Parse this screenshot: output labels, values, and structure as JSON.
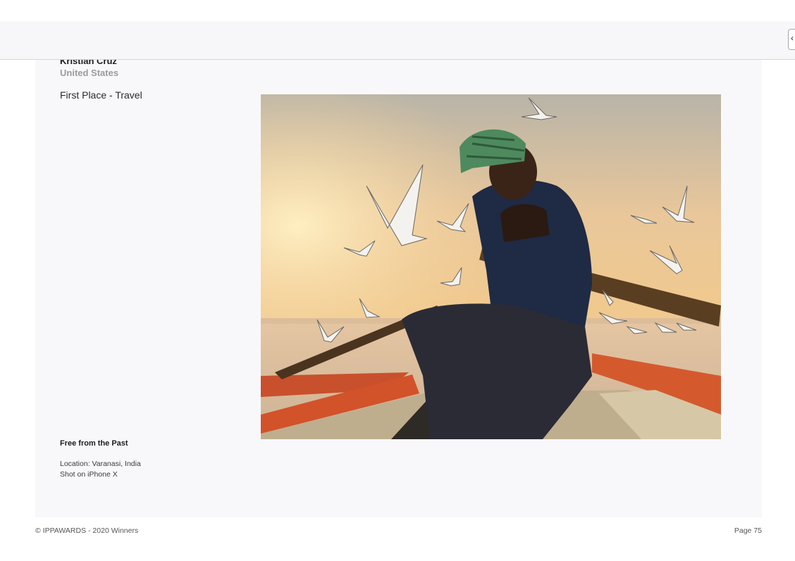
{
  "toolbar": {
    "button_glyph": "‹"
  },
  "entry": {
    "photographer": "Kristian Cruz",
    "country": "United States",
    "award": "First Place - Travel",
    "photo_title": "Free from the Past",
    "location": "Location: Varanasi, India",
    "device": "Shot on iPhone X"
  },
  "footer": {
    "copyright": "© IPPAWARDS - 2020 Winners",
    "page": "Page 75"
  },
  "colors": {
    "page_background": "#f8f8fa",
    "boat_orange": "#d2522a",
    "sky_gold": "#f0c27a"
  }
}
